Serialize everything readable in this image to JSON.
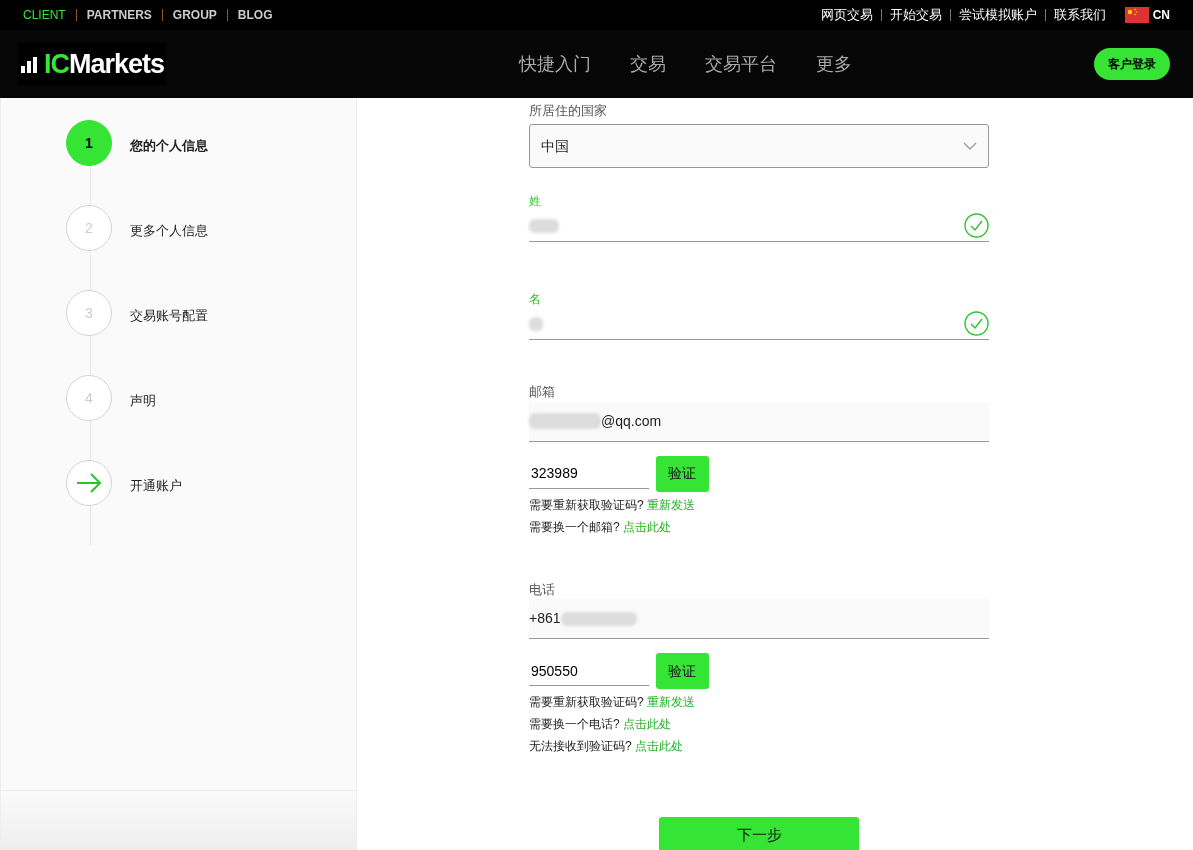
{
  "top_links": [
    {
      "label": "CLIENT",
      "selected": true
    },
    {
      "label": "PARTNERS",
      "selected": false
    },
    {
      "label": "GROUP",
      "selected": false
    },
    {
      "label": "BLOG",
      "selected": false
    }
  ],
  "top_right_links": [
    "网页交易",
    "开始交易",
    "尝试模拟账户",
    "联系我们"
  ],
  "language": "CN",
  "nav": {
    "logo_accent": "IC",
    "logo_rest": "Markets",
    "menu": [
      "快捷入门",
      "交易",
      "交易平台",
      "更多"
    ],
    "login_button": "客户登录"
  },
  "steps": [
    {
      "kind": "number",
      "number": "1",
      "label": "您的个人信息",
      "selected": true
    },
    {
      "kind": "number",
      "number": "2",
      "label": "更多个人信息",
      "selected": false
    },
    {
      "kind": "number",
      "number": "3",
      "label": "交易账号配置",
      "selected": false
    },
    {
      "kind": "number",
      "number": "4",
      "label": "声明",
      "selected": false
    },
    {
      "kind": "arrow",
      "label": "开通账户",
      "selected": false
    }
  ],
  "form": {
    "country": {
      "label": "所居住的国家",
      "value": "中国"
    },
    "names": [
      {
        "label": "姓",
        "valid": true
      },
      {
        "label": "名",
        "valid": true
      }
    ],
    "contacts": [
      {
        "label": "邮箱",
        "value": "@qq.com",
        "prefix_hidden": true,
        "code": "323989",
        "verify_button": "验证",
        "hints": [
          {
            "text": "需要重新获取验证码?",
            "link": "重新发送"
          },
          {
            "text": "需要换一个邮箱?",
            "link": "点击此处"
          }
        ]
      },
      {
        "label": "电话",
        "value": "+861",
        "prefix_hidden": false,
        "code": "950550",
        "verify_button": "验证",
        "hints": [
          {
            "text": "需要重新获取验证码?",
            "link": "重新发送"
          },
          {
            "text": "需要换一个电话?",
            "link": "点击此处"
          },
          {
            "text": "无法接收到验证码?",
            "link": "点击此处"
          }
        ]
      }
    ],
    "next_button": "下一步"
  }
}
